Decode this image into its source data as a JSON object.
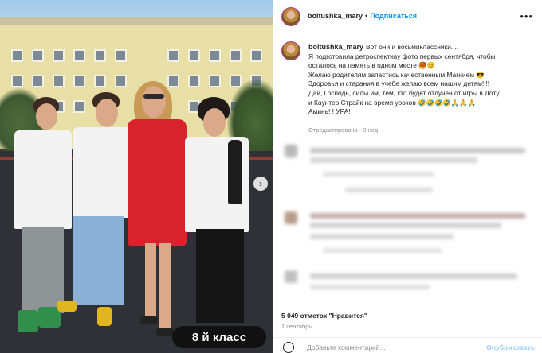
{
  "photo": {
    "badge_text": "8 й класс",
    "next_icon": "chevron-right-icon"
  },
  "post_header": {
    "username": "boltushka_mary",
    "separator": "•",
    "follow_label": "Подписаться",
    "more_label": "•••"
  },
  "caption": {
    "username": "boltushka_mary",
    "lines": [
      "Вот они и восьмиклассники....",
      "Я подготовила ретроспективу фото первых сентября, чтобы",
      "осталось на память в одном месте 🥮😊",
      "Желаю родителям запастись качественным Магнием 😎",
      "Здоровья и старания в учебе желаю всем нашим детям!!!!",
      "Дай, Господь, силы им, тем, кто будет отлучён от игры в Доту",
      "и Каунтер Страйк на время уроков 🤣🤣🤣🤣🙏🙏🙏",
      "Аминь! ! УРА!"
    ],
    "meta": "Отредактировано · 3 нед."
  },
  "likes": "5 049 отметок \"Нравится\"",
  "date": "1 сентябрь",
  "comment": {
    "placeholder": "Добавьте комментарий...",
    "publish_label": "Опубликовать"
  },
  "colors": {
    "accent": "#0095f6",
    "dress": "#d8232c"
  }
}
